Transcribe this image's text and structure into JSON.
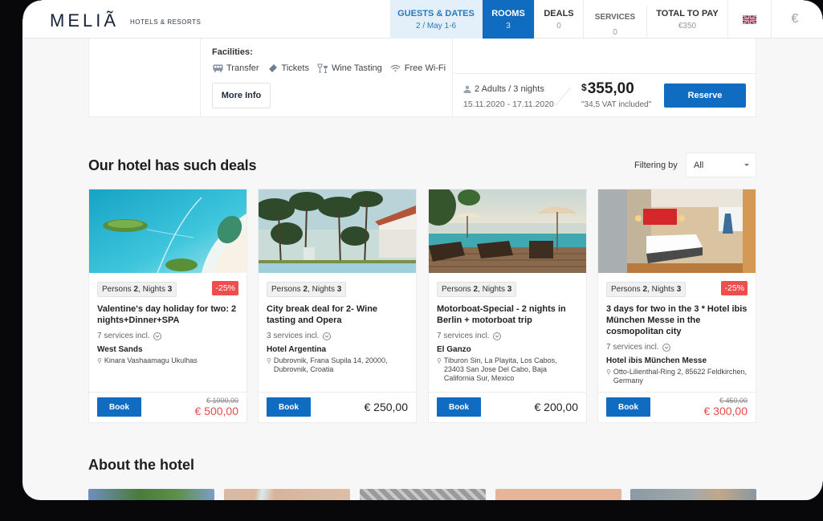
{
  "header": {
    "logo": "MELIÃ",
    "logo_sub": "HOTELS & RESORTS",
    "nav": [
      {
        "label": "GUESTS & DATES",
        "sub": "2 / May 1-6",
        "state": "visited"
      },
      {
        "label": "ROOMS",
        "sub": "3",
        "state": "active"
      },
      {
        "label": "DEALS",
        "sub": "0",
        "state": "default"
      },
      {
        "label": "SERVICES",
        "sub": "0",
        "state": "default"
      },
      {
        "label": "TOTAL TO PAY",
        "sub": "€350",
        "state": "default"
      }
    ],
    "language_icon": "uk-flag-icon",
    "currency_symbol": "€"
  },
  "room": {
    "facilities_label": "Facilities:",
    "facilities": [
      {
        "icon": "bus-icon",
        "label": "Transfer"
      },
      {
        "icon": "ticket-icon",
        "label": "Tickets"
      },
      {
        "icon": "wine-glasses-icon",
        "label": "Wine Tasting"
      },
      {
        "icon": "wifi-icon",
        "label": "Free Wi-Fi"
      }
    ],
    "more_info_label": "More Info",
    "guests": "2 Adults / 3 nights",
    "dates": "15.11.2020 - 17.11.2020",
    "currency": "$",
    "price": "355,00",
    "vat": "\"34,5 VAT included\"",
    "reserve_label": "Reserve"
  },
  "deals": {
    "title": "Our hotel has such deals",
    "filter_label": "Filtering by",
    "filter_value": "All",
    "cards": [
      {
        "persons_label": "Persons",
        "persons": "2",
        "nights_label": "Nights",
        "nights": "3",
        "discount": "-25%",
        "title": "Valentine's day holiday for two: 2 nights+Dinner+SPA",
        "services": "7 services incl.",
        "hotel": "West Sands",
        "address": "Kinara Vashaamagu Ukulhas",
        "book_label": "Book",
        "old_price": "€ 1000,00",
        "price": "€ 500,00",
        "image": "aerial-islands"
      },
      {
        "persons_label": "Persons",
        "persons": "2",
        "nights_label": "Nights",
        "nights": "3",
        "discount": "",
        "title": "City break deal for 2- Wine tasting and Opera",
        "services": "3 services incl.",
        "hotel": "Hotel Argentina",
        "address": "Dubrovnik, Frana Supila 14, 20000, Dubrovnik, Croatia",
        "book_label": "Book",
        "old_price": "",
        "price": "€ 250,00",
        "image": "palm-resort"
      },
      {
        "persons_label": "Persons",
        "persons": "2",
        "nights_label": "Nights",
        "nights": "3",
        "discount": "",
        "title": "Motorboat-Special - 2 nights in Berlin + motorboat trip",
        "services": "7 services incl.",
        "hotel": "El Ganzo",
        "address": "Tiburon Sin, La Playita, Los Cabos, 23403 San Jose Del Cabo, Baja California Sur, Mexico",
        "book_label": "Book",
        "old_price": "",
        "price": "€ 200,00",
        "image": "pool-deck"
      },
      {
        "persons_label": "Persons",
        "persons": "2",
        "nights_label": "Nights",
        "nights": "3",
        "discount": "-25%",
        "title": "3 days for two in the 3 * Hotel ibis München Messe in the cosmopolitan city",
        "services": "7 services incl.",
        "hotel": "Hotel ibis München Messe",
        "address": "Otto-Lilienthal-Ring 2, 85622 Feldkirchen, Germany",
        "book_label": "Book",
        "old_price": "€ 450,00",
        "price": "€ 300,00",
        "image": "hotel-room"
      }
    ]
  },
  "about": {
    "title": "About the hotel"
  },
  "colors": {
    "primary": "#0f6cc1",
    "nav_visited_bg": "#e3f0f9",
    "discount": "#ef4e4e",
    "sale_price": "#e94b4b"
  }
}
